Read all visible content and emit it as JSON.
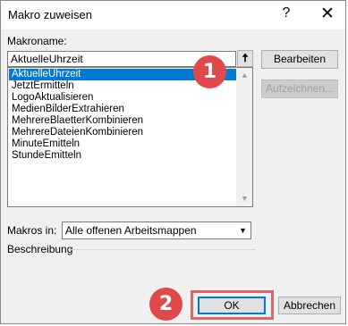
{
  "window": {
    "title": "Makro zuweisen",
    "help_glyph": "?",
    "close_glyph": "✕"
  },
  "labels": {
    "macro_name": "Makroname:",
    "macros_in": "Makros in:",
    "description": "Beschreibung"
  },
  "macro_name_value": "AktuelleUhrzeit",
  "macro_list": [
    {
      "label": "AktuelleUhrzeit",
      "selected": true
    },
    {
      "label": "JetztErmitteln",
      "selected": false
    },
    {
      "label": "LogoAktualisieren",
      "selected": false
    },
    {
      "label": "MedienBilderExtrahieren",
      "selected": false
    },
    {
      "label": "MehrereBlaetterKombinieren",
      "selected": false
    },
    {
      "label": "MehrereDateienKombinieren",
      "selected": false
    },
    {
      "label": "MinuteEmitteln",
      "selected": false
    },
    {
      "label": "StundeEmitteln",
      "selected": false
    }
  ],
  "macros_in_value": "Alle offenen Arbeitsmappen",
  "buttons": {
    "edit": "Bearbeiten",
    "record": "Aufzeichnen...",
    "ok": "OK",
    "cancel": "Abbrechen"
  },
  "annotations": {
    "badge1": "1",
    "badge2": "2"
  },
  "icons": {
    "collapse": "up-arrow-icon",
    "dropdown": "chevron-down-icon",
    "scroll_up": "scroll-up-icon",
    "scroll_down": "scroll-down-icon"
  },
  "colors": {
    "selection": "#0078d7",
    "badge": "#e0484a",
    "highlight": "#e06666"
  }
}
